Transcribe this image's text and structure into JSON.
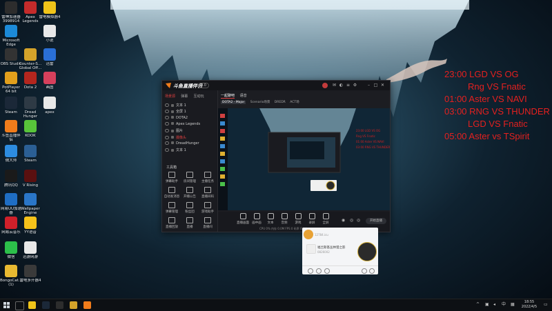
{
  "desktop_icons": [
    {
      "label": "雷神加速器",
      "sub": "3998914",
      "color": "#2d2d2d"
    },
    {
      "label": "Apex",
      "sub": "Legends",
      "color": "#c42b2b"
    },
    {
      "label": "雷电模拟器4",
      "sub": "",
      "color": "#f0c419"
    },
    {
      "label": "Microsoft",
      "sub": "Edge",
      "color": "#1c8ad8"
    },
    {
      "label": "小说",
      "sub": "",
      "color": "#e8e8e8"
    },
    {
      "label": "OBS Studio",
      "sub": "",
      "color": "#333"
    },
    {
      "label": "Counter-S...",
      "sub": "Global Off...",
      "color": "#d4a32a"
    },
    {
      "label": "迅雷",
      "sub": "",
      "color": "#2a6fd6"
    },
    {
      "label": "PotPlayer",
      "sub": "64 bit",
      "color": "#e2a01c"
    },
    {
      "label": "Dota 2",
      "sub": "",
      "color": "#b3261e"
    },
    {
      "label": "画图",
      "sub": "",
      "color": "#d6405c"
    },
    {
      "label": "Steam",
      "sub": "",
      "color": "#1b2838"
    },
    {
      "label": "Dread",
      "sub": "Hunger",
      "color": "#2e3a45"
    },
    {
      "label": "apex",
      "sub": "",
      "color": "#e8e8e8"
    },
    {
      "label": "斗鱼直播伴",
      "sub": "侣",
      "color": "#f07c1b"
    },
    {
      "label": "KOOK",
      "sub": "",
      "color": "#58c43a"
    },
    {
      "label": "微大师",
      "sub": "",
      "color": "#2d8ce0"
    },
    {
      "label": "Steam",
      "sub": "",
      "color": "#2b5f94"
    },
    {
      "label": "腾讯QQ",
      "sub": "",
      "color": "#1a1a1a"
    },
    {
      "label": "V Rising",
      "sub": "",
      "color": "#5a1010"
    },
    {
      "label": "网易UU加速",
      "sub": "器",
      "color": "#1f6ec4"
    },
    {
      "label": "Wallpaper",
      "sub": "Engine",
      "color": "#2a76c8"
    },
    {
      "label": "网易云音乐",
      "sub": "",
      "color": "#d0202a"
    },
    {
      "label": "YY语音",
      "sub": "",
      "color": "#f5c21a"
    },
    {
      "label": "微信",
      "sub": "",
      "color": "#2cbf4a"
    },
    {
      "label": "迅游网游",
      "sub": "",
      "color": "#e8e8e8"
    },
    {
      "label": "BongoCat...",
      "sub": "(1)",
      "color": "#e8b931"
    },
    {
      "label": "雷电多开器4",
      "sub": "",
      "color": "#3a3a3a"
    }
  ],
  "schedule": [
    "23:00 LGD VS OG",
    "Rng  VS Fnatic",
    "01:00 Aster VS NAVI",
    "03:00 RNG VS THUNDER",
    "LGD VS Fnatic",
    "05:00 Aster vs TSpirit"
  ],
  "app": {
    "title": "斗鱼直播伴侣",
    "version": "4.0",
    "sidebar_tabs": [
      "场景源",
      "弹幕",
      "互动玩"
    ],
    "sources": [
      "文本 1",
      "全屏 1",
      "DOTA2",
      "Apex Legends",
      "图片",
      "摄像头",
      "DreadHunger",
      "文本 1"
    ],
    "tool_title": "工具箱",
    "tools": [
      "弹幕助手",
      "房间管理",
      "主播任务",
      "自动发消息",
      "开播公告",
      "直播间码",
      "弹幕管理",
      "粉丝团",
      "游戏助手",
      "直播回放",
      "直播",
      "直播间"
    ],
    "main_tabs": [
      "一起聊吧",
      "语音"
    ],
    "scene_tabs": [
      "DOTA2 - Major",
      "Scenario场景",
      "DREDR",
      "ACT场"
    ],
    "bottom_tools": [
      "直播画面",
      "画中画",
      "文本",
      "音频",
      "游戏",
      "录屏",
      "全屏"
    ],
    "live_button": "开始直播",
    "status": "CPU 0%  内存 0.0M  FPS 0  码率 0kb/s"
  },
  "chat": {
    "sub1": "12784.icu",
    "title": "福兰斯基丛林猎之影",
    "sub2": "0826002"
  },
  "clock": {
    "time": "18:55",
    "date": "2022/4/5"
  }
}
